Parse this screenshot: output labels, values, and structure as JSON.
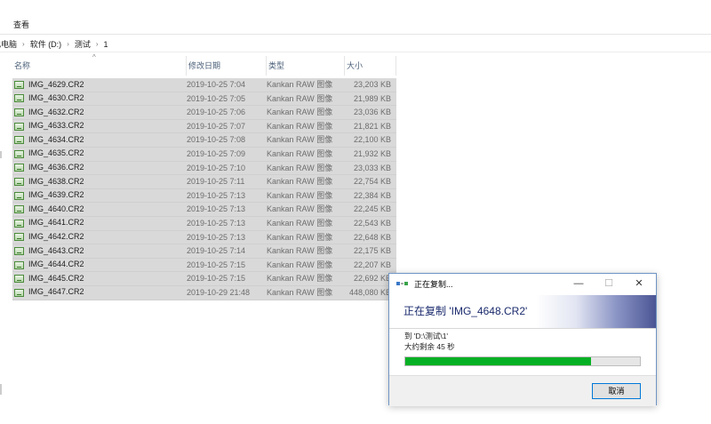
{
  "ribbon": {
    "view_tab": "查看"
  },
  "breadcrumb": [
    "此电脑",
    "软件 (D:)",
    "测试",
    "1"
  ],
  "columns": {
    "name": "名称",
    "date": "修改日期",
    "type": "类型",
    "size": "大小"
  },
  "files": [
    {
      "name": "IMG_4629.CR2",
      "date": "2019-10-25 7:04",
      "type": "Kankan RAW 图像",
      "size": "23,203 KB"
    },
    {
      "name": "IMG_4630.CR2",
      "date": "2019-10-25 7:05",
      "type": "Kankan RAW 图像",
      "size": "21,989 KB"
    },
    {
      "name": "IMG_4632.CR2",
      "date": "2019-10-25 7:06",
      "type": "Kankan RAW 图像",
      "size": "23,036 KB"
    },
    {
      "name": "IMG_4633.CR2",
      "date": "2019-10-25 7:07",
      "type": "Kankan RAW 图像",
      "size": "21,821 KB"
    },
    {
      "name": "IMG_4634.CR2",
      "date": "2019-10-25 7:08",
      "type": "Kankan RAW 图像",
      "size": "22,100 KB"
    },
    {
      "name": "IMG_4635.CR2",
      "date": "2019-10-25 7:09",
      "type": "Kankan RAW 图像",
      "size": "21,932 KB"
    },
    {
      "name": "IMG_4636.CR2",
      "date": "2019-10-25 7:10",
      "type": "Kankan RAW 图像",
      "size": "23,033 KB"
    },
    {
      "name": "IMG_4638.CR2",
      "date": "2019-10-25 7:11",
      "type": "Kankan RAW 图像",
      "size": "22,754 KB"
    },
    {
      "name": "IMG_4639.CR2",
      "date": "2019-10-25 7:13",
      "type": "Kankan RAW 图像",
      "size": "22,384 KB"
    },
    {
      "name": "IMG_4640.CR2",
      "date": "2019-10-25 7:13",
      "type": "Kankan RAW 图像",
      "size": "22,245 KB"
    },
    {
      "name": "IMG_4641.CR2",
      "date": "2019-10-25 7:13",
      "type": "Kankan RAW 图像",
      "size": "22,543 KB"
    },
    {
      "name": "IMG_4642.CR2",
      "date": "2019-10-25 7:13",
      "type": "Kankan RAW 图像",
      "size": "22,648 KB"
    },
    {
      "name": "IMG_4643.CR2",
      "date": "2019-10-25 7:14",
      "type": "Kankan RAW 图像",
      "size": "22,175 KB"
    },
    {
      "name": "IMG_4644.CR2",
      "date": "2019-10-25 7:15",
      "type": "Kankan RAW 图像",
      "size": "22,207 KB"
    },
    {
      "name": "IMG_4645.CR2",
      "date": "2019-10-25 7:15",
      "type": "Kankan RAW 图像",
      "size": "22,692 KB"
    },
    {
      "name": "IMG_4647.CR2",
      "date": "2019-10-29 21:48",
      "type": "Kankan RAW 图像",
      "size": "448,080 KB"
    }
  ],
  "dialog": {
    "title": "正在复制...",
    "heading": "正在复制 'IMG_4648.CR2'",
    "destination": "到 'D:\\测试\\1'",
    "remaining": "大约剩余 45 秒",
    "progress_percent": 79,
    "progress_color": "#06b025",
    "cancel_label": "取消",
    "minimize_glyph": "—",
    "maximize_glyph": "☐",
    "close_glyph": "✕"
  }
}
